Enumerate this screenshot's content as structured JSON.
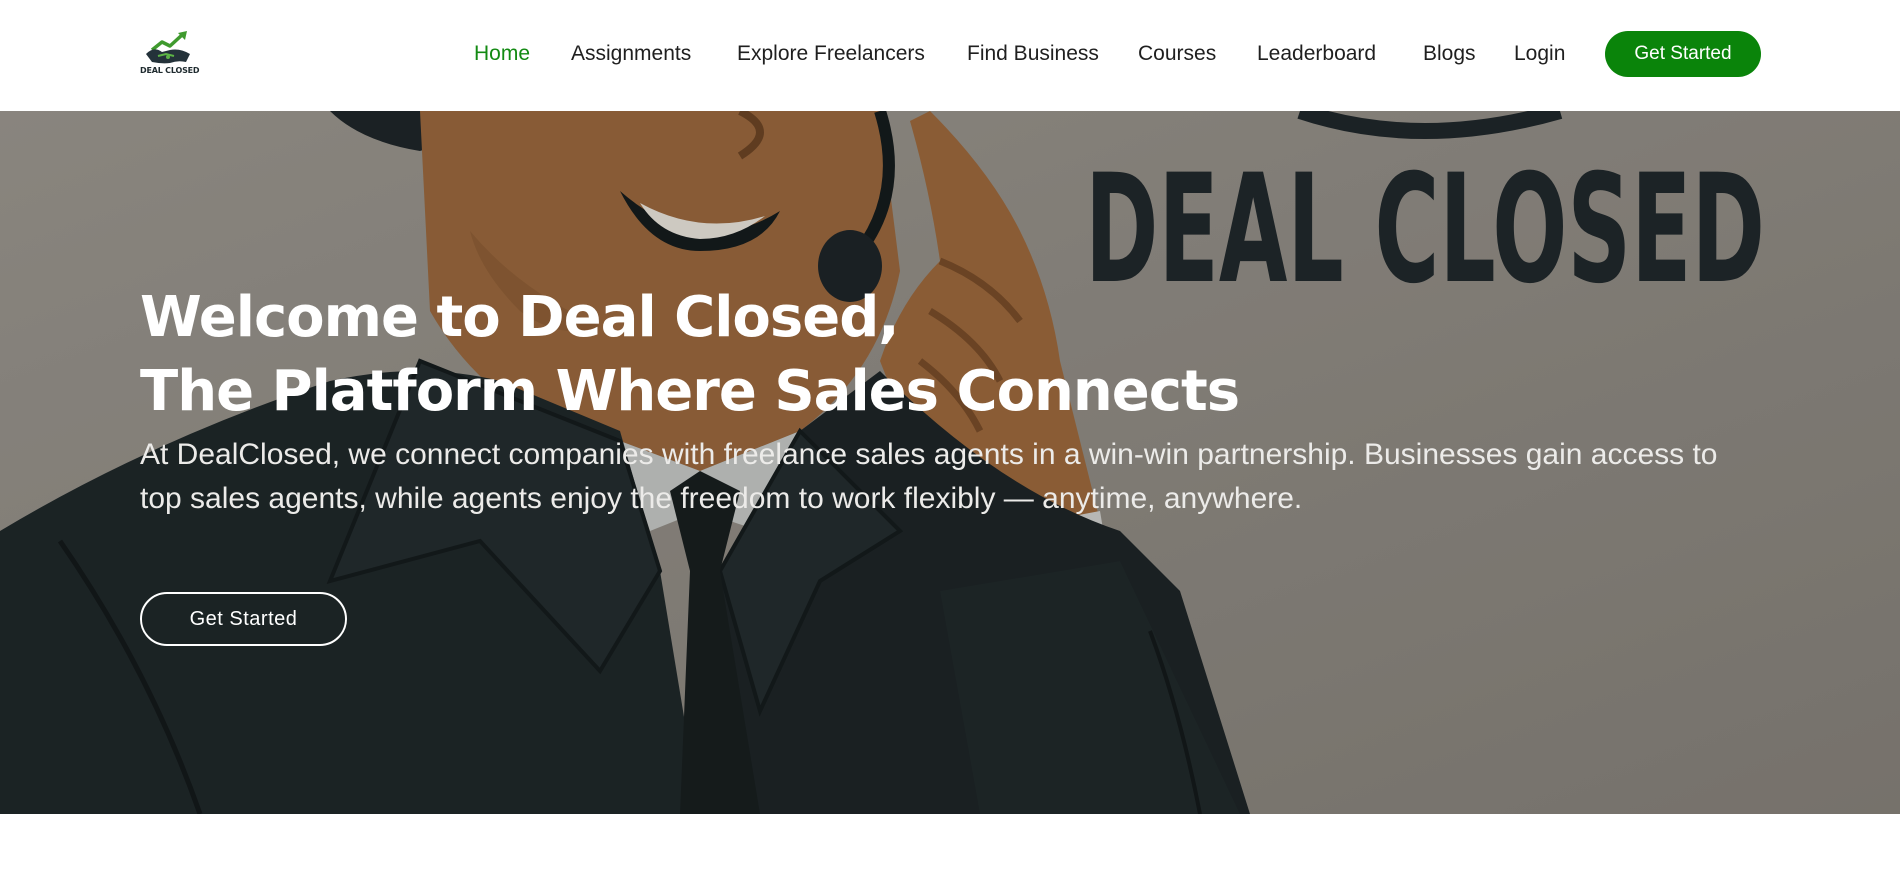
{
  "brand": {
    "logo_text": "DEAL CLOSED",
    "accent_color": "#0a840a"
  },
  "nav": {
    "items": [
      {
        "label": "Home",
        "active": true
      },
      {
        "label": "Assignments",
        "active": false
      },
      {
        "label": "Explore Freelancers",
        "active": false
      },
      {
        "label": "Find Business",
        "active": false
      },
      {
        "label": "Courses",
        "active": false
      },
      {
        "label": "Leaderboard",
        "active": false
      },
      {
        "label": "Blogs",
        "active": false
      },
      {
        "label": "Login",
        "active": false
      }
    ],
    "cta_label": "Get Started"
  },
  "hero": {
    "background_text": "DEAL CLOSED",
    "title_line1": "Welcome to Deal Closed,",
    "title_line2": "The Platform Where Sales Connects",
    "description": "At DealClosed, we connect companies with freelance sales agents in a win-win partnership. Businesses gain access to top sales agents, while agents enjoy the freedom to work flexibly — anytime, anywhere.",
    "cta_label": "Get Started"
  },
  "icons": {
    "logo": "handshake-chart-logo-icon"
  }
}
